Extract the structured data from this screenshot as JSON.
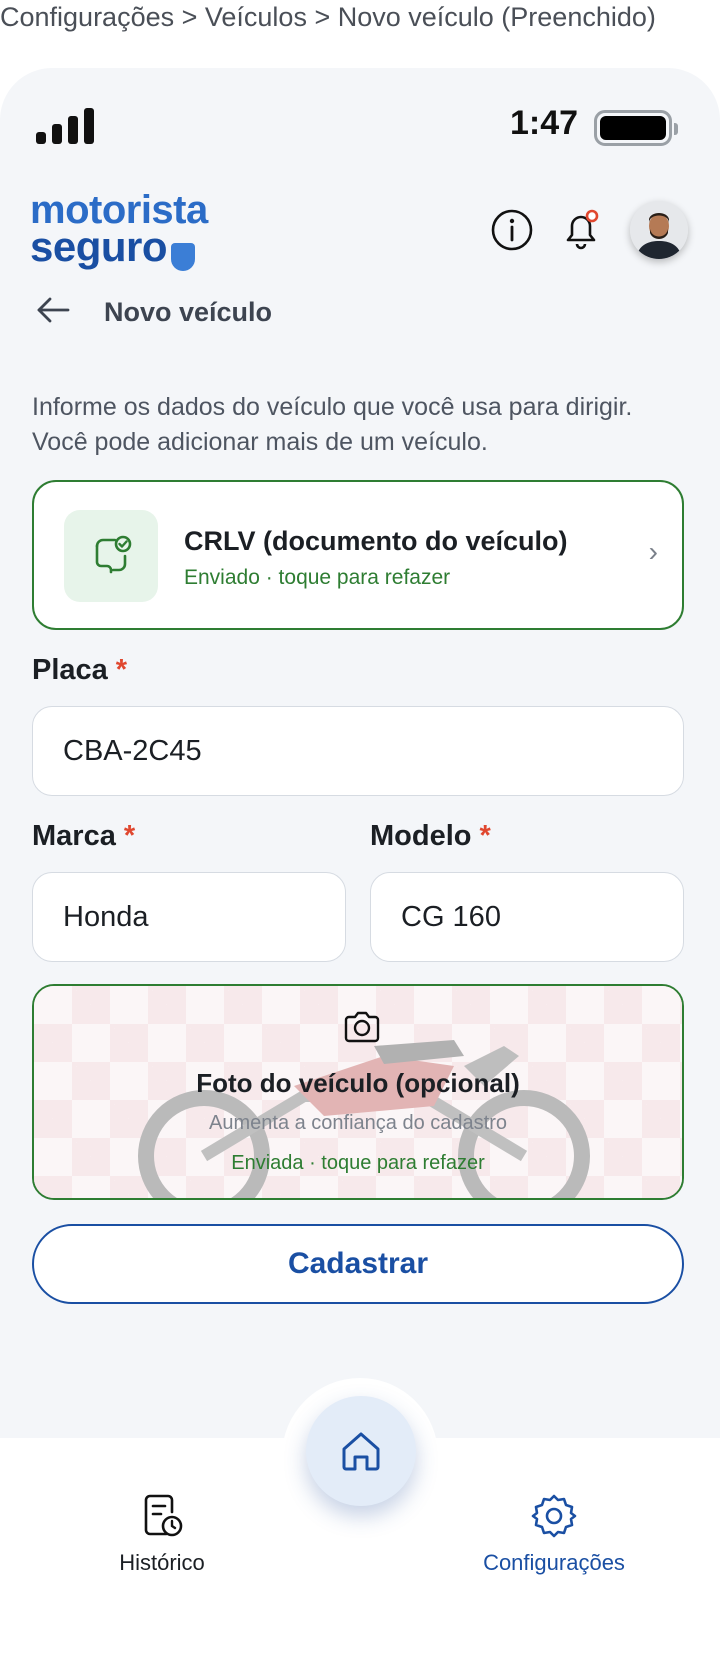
{
  "breadcrumb": "Configurações > Veículos > Novo veículo (Preenchido)",
  "status_bar": {
    "time": "1:47"
  },
  "header": {
    "logo_line1": "motorista",
    "logo_line2": "seguro",
    "icons": [
      "info-icon",
      "bell-icon",
      "avatar"
    ]
  },
  "page": {
    "back_icon": "arrow-left-icon",
    "title": "Novo veículo",
    "intro": "Informe os dados do veículo que você usa para dirigir. Você pode adicionar mais de um veículo."
  },
  "crlv_card": {
    "title": "CRLV (documento do veículo)",
    "status": "Enviado · toque para refazer",
    "chevron": "›",
    "icon": "document-check-icon"
  },
  "form": {
    "placa": {
      "label": "Placa",
      "required_mark": "*",
      "value": "CBA-2C45"
    },
    "marca": {
      "label": "Marca",
      "required_mark": "*",
      "value": "Honda"
    },
    "modelo": {
      "label": "Modelo",
      "required_mark": "*",
      "value": "CG 160"
    }
  },
  "photo_card": {
    "title": "Foto do veículo (opcional)",
    "subtitle": "Aumenta a confiança do cadastro",
    "status": "Enviada · toque para refazer",
    "icon": "camera-icon"
  },
  "submit_label": "Cadastrar",
  "tabbar": {
    "left_label": "Histórico",
    "right_label": "Configurações",
    "center_icon": "home-icon"
  },
  "colors": {
    "primary": "#1a4fa3",
    "success": "#2e7d32",
    "required": "#e0472f",
    "background": "#f4f6f9"
  }
}
